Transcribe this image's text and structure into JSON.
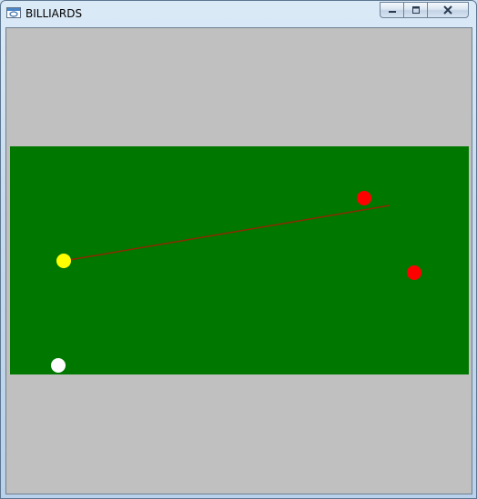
{
  "window": {
    "title": "BILLIARDS",
    "icon": "app-window-icon",
    "controls": [
      "minimize-icon",
      "maximize-icon",
      "close-icon"
    ]
  },
  "colors": {
    "background": "#c0c0c0",
    "felt": "#007800",
    "cue_ball": "#ffffff",
    "object_ball": "#ffff00",
    "target_balls": "#ff0000",
    "aim_line": "#8b2a00"
  },
  "balls": [
    {
      "name": "white-ball",
      "color": "#ffffff"
    },
    {
      "name": "yellow-ball",
      "color": "#ffff00"
    },
    {
      "name": "red-ball-1",
      "color": "#ff0000"
    },
    {
      "name": "red-ball-2",
      "color": "#ff0000"
    }
  ]
}
